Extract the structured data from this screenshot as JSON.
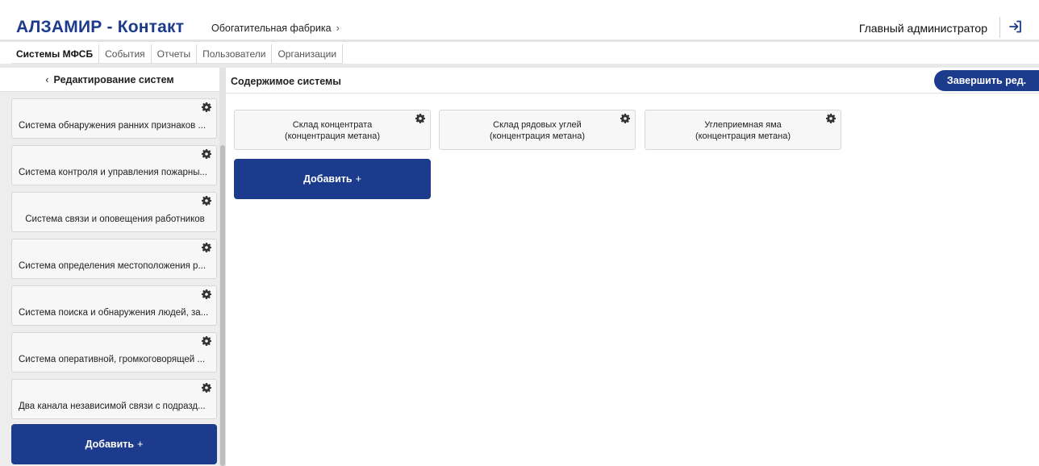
{
  "header": {
    "brand": "АЛЗАМИР - Контакт",
    "breadcrumb": "Обогатительная фабрика",
    "breadcrumb_chevron": "›",
    "user": "Главный администратор",
    "logout_icon": "logout-icon"
  },
  "tabs": [
    {
      "label": "Системы МФСБ",
      "active": true
    },
    {
      "label": "События",
      "active": false
    },
    {
      "label": "Отчеты",
      "active": false
    },
    {
      "label": "Пользователи",
      "active": false
    },
    {
      "label": "Организации",
      "active": false
    }
  ],
  "left_panel": {
    "back_chevron": "‹",
    "title": "Редактирование систем",
    "systems": [
      {
        "label": "Система обнаружения ранних признаков ..."
      },
      {
        "label": "Система контроля и управления пожарны..."
      },
      {
        "label": "Система связи и оповещения работников"
      },
      {
        "label": "Система определения местоположения р..."
      },
      {
        "label": "Система поиска и обнаружения людей, за..."
      },
      {
        "label": "Система оперативной, громкоговорящей ..."
      },
      {
        "label": "Два канала независимой связи с подразд..."
      }
    ],
    "add_label": "Добавить",
    "add_plus": "+"
  },
  "right_panel": {
    "title": "Содержимое системы",
    "finish_label": "Завершить ред.",
    "elements": [
      {
        "line1": "Склад концентрата",
        "line2": "(концентрация метана)"
      },
      {
        "line1": "Склад рядовых углей",
        "line2": "(концентрация метана)"
      },
      {
        "line1": "Углеприемная яма",
        "line2": "(концентрация метана)"
      }
    ],
    "add_label": "Добавить",
    "add_plus": "+"
  },
  "colors": {
    "accent": "#1c3b8c",
    "panel_bg": "#ededed",
    "card_bg": "#f7f7f7"
  }
}
